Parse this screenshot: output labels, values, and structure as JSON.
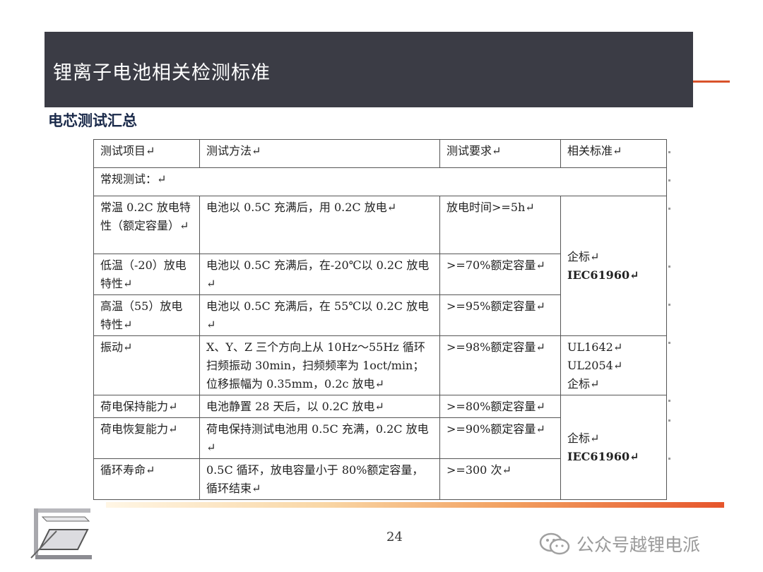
{
  "header": {
    "title": "锂离子电池相关检测标准"
  },
  "subtitle": "电芯测试汇总",
  "table": {
    "headers": [
      "测试项目↵",
      "测试方法↵",
      "测试要求↵",
      "相关标准↵"
    ],
    "section": "常规测试：↵",
    "rows": [
      {
        "item": "常温 0.2C 放电特性（额定容量）↵",
        "method": "电池以 0.5C 充满后，用 0.2C 放电↵",
        "req": "放电时间>=5h↵"
      },
      {
        "item": "低温（-20）放电特性↵",
        "method": "电池以 0.5C 充满后，在-20℃以 0.2C 放电↵",
        "req": ">=70%额定容量↵"
      },
      {
        "item": "高温（55）放电特性↵",
        "method": "电池以 0.5C 充满后，在 55℃以 0.2C 放电↵",
        "req": ">=95%额定容量↵"
      },
      {
        "item": "振动↵",
        "method": "X、Y、Z 三个方向上从 10Hz～55Hz 循环扫频振动 30min，扫频频率为 1oct/min；位移振幅为 0.35mm，0.2c 放电↵",
        "req": ">=98%额定容量↵"
      },
      {
        "item": "荷电保持能力↵",
        "method": "电池静置 28 天后，以 0.2C 放电↵",
        "req": ">=80%额定容量↵"
      },
      {
        "item": "荷电恢复能力↵",
        "method": "荷电保持测试电池用 0.5C 充满，0.2C 放电↵",
        "req": ">=90%额定容量↵"
      },
      {
        "item": "循环寿命↵",
        "method": "0.5C 循环，放电容量小于 80%额定容量，循环结束↵",
        "req": ">=300 次↵"
      }
    ],
    "std_group1": [
      "企标↵",
      "IEC61960↵"
    ],
    "std_vibration": [
      "UL1642↵",
      "UL2054↵",
      "企标↵"
    ],
    "std_group2": [
      "企标↵",
      "IEC61960↵"
    ]
  },
  "footer": {
    "page_number": "24",
    "watermark": "公众号越锂电派"
  },
  "colors": {
    "header_bg": "#3b3c45",
    "accent": "#e6552c"
  }
}
